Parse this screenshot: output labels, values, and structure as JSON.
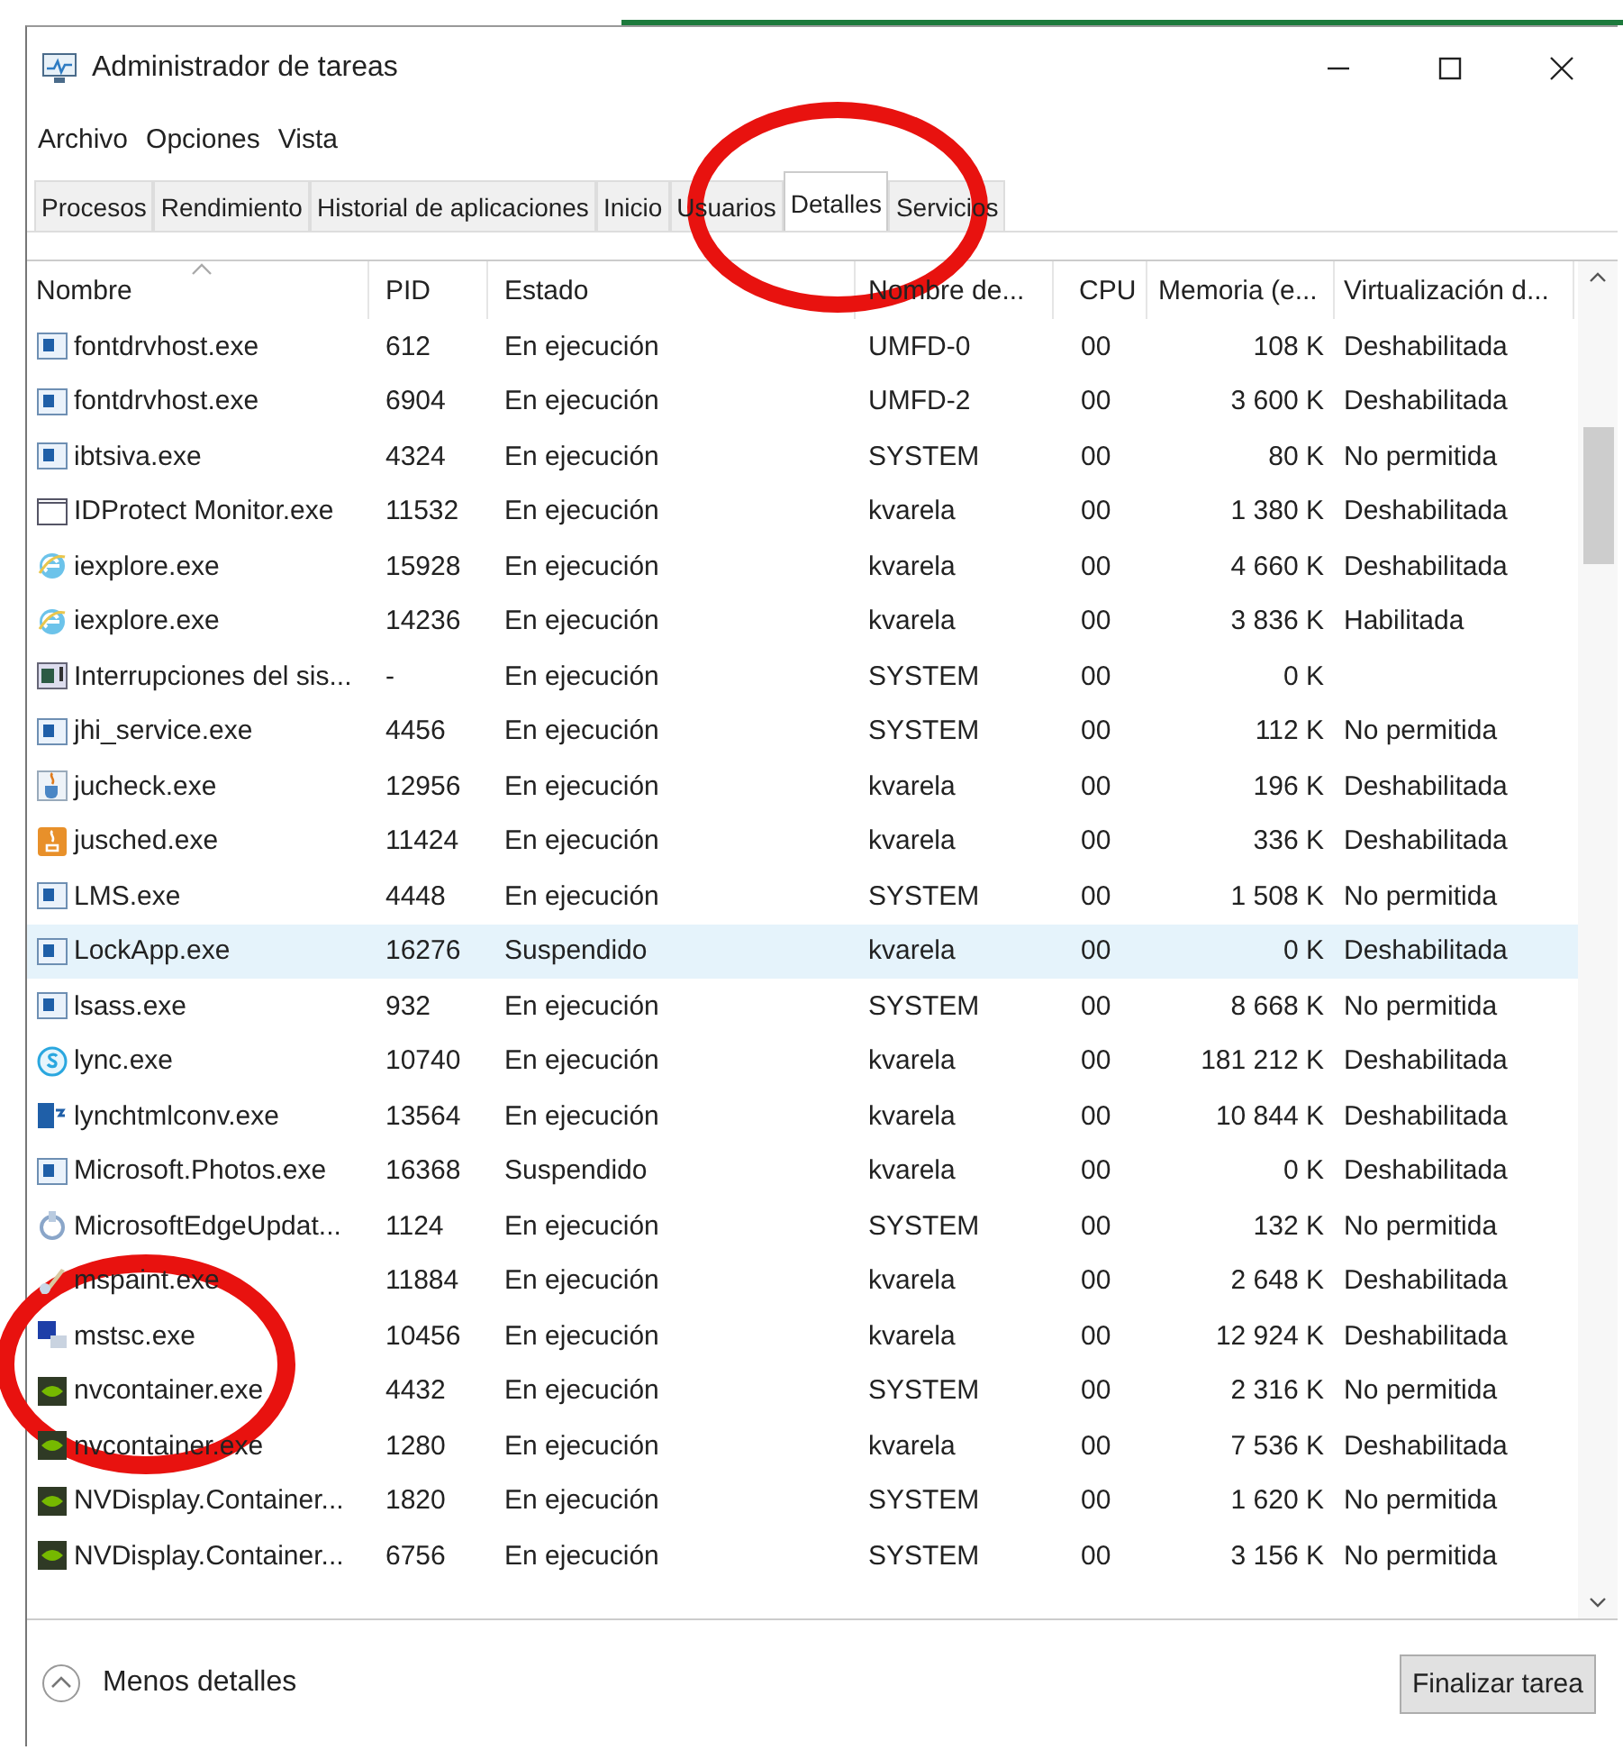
{
  "window": {
    "title": "Administrador de tareas"
  },
  "menu": [
    "Archivo",
    "Opciones",
    "Vista"
  ],
  "tabs": [
    {
      "label": "Procesos",
      "selected": false
    },
    {
      "label": "Rendimiento",
      "selected": false
    },
    {
      "label": "Historial de aplicaciones",
      "selected": false
    },
    {
      "label": "Inicio",
      "selected": false
    },
    {
      "label": "Usuarios",
      "selected": false
    },
    {
      "label": "Detalles",
      "selected": true
    },
    {
      "label": "Servicios",
      "selected": false
    }
  ],
  "table": {
    "columns": [
      "Nombre",
      "PID",
      "Estado",
      "Nombre de...",
      "CPU",
      "Memoria (e...",
      "Virtualización d..."
    ],
    "rows": [
      {
        "kind": "app",
        "cells": [
          "fontdrvhost.exe",
          "612",
          "En ejecución",
          "UMFD-0",
          "00",
          "108 K",
          "Deshabilitada"
        ],
        "selected": false
      },
      {
        "kind": "app",
        "cells": [
          "fontdrvhost.exe",
          "6904",
          "En ejecución",
          "UMFD-2",
          "00",
          "3 600 K",
          "Deshabilitada"
        ],
        "selected": false
      },
      {
        "kind": "app",
        "cells": [
          "ibtsiva.exe",
          "4324",
          "En ejecución",
          "SYSTEM",
          "00",
          "80 K",
          "No permitida"
        ],
        "selected": false
      },
      {
        "kind": "window",
        "cells": [
          "IDProtect Monitor.exe",
          "11532",
          "En ejecución",
          "kvarela",
          "00",
          "1 380 K",
          "Deshabilitada"
        ],
        "selected": false
      },
      {
        "kind": "browser",
        "cells": [
          "iexplore.exe",
          "15928",
          "En ejecución",
          "kvarela",
          "00",
          "4 660 K",
          "Deshabilitada"
        ],
        "selected": false
      },
      {
        "kind": "browser",
        "cells": [
          "iexplore.exe",
          "14236",
          "En ejecución",
          "kvarela",
          "00",
          "3 836 K",
          "Habilitada"
        ],
        "selected": false
      },
      {
        "kind": "system",
        "cells": [
          "Interrupciones del sis...",
          "-",
          "En ejecución",
          "SYSTEM",
          "00",
          "0 K",
          ""
        ],
        "selected": false
      },
      {
        "kind": "app",
        "cells": [
          "jhi_service.exe",
          "4456",
          "En ejecución",
          "SYSTEM",
          "00",
          "112 K",
          "No permitida"
        ],
        "selected": false
      },
      {
        "kind": "cup",
        "cells": [
          "jucheck.exe",
          "12956",
          "En ejecución",
          "kvarela",
          "00",
          "196 K",
          "Deshabilitada"
        ],
        "selected": false
      },
      {
        "kind": "cup-orange",
        "cells": [
          "jusched.exe",
          "11424",
          "En ejecución",
          "kvarela",
          "00",
          "336 K",
          "Deshabilitada"
        ],
        "selected": false
      },
      {
        "kind": "app",
        "cells": [
          "LMS.exe",
          "4448",
          "En ejecución",
          "SYSTEM",
          "00",
          "1 508 K",
          "No permitida"
        ],
        "selected": false
      },
      {
        "kind": "app",
        "cells": [
          "LockApp.exe",
          "16276",
          "Suspendido",
          "kvarela",
          "00",
          "0 K",
          "Deshabilitada"
        ],
        "selected": true
      },
      {
        "kind": "app",
        "cells": [
          "lsass.exe",
          "932",
          "En ejecución",
          "SYSTEM",
          "00",
          "8 668 K",
          "No permitida"
        ],
        "selected": false
      },
      {
        "kind": "chat",
        "cells": [
          "lync.exe",
          "10740",
          "En ejecución",
          "kvarela",
          "00",
          "181 212 K",
          "Deshabilitada"
        ],
        "selected": false
      },
      {
        "kind": "convert",
        "cells": [
          "lynchtmlconv.exe",
          "13564",
          "En ejecución",
          "kvarela",
          "00",
          "10 844 K",
          "Deshabilitada"
        ],
        "selected": false
      },
      {
        "kind": "app",
        "cells": [
          "Microsoft.Photos.exe",
          "16368",
          "Suspendido",
          "kvarela",
          "00",
          "0 K",
          "Deshabilitada"
        ],
        "selected": false
      },
      {
        "kind": "update",
        "cells": [
          "MicrosoftEdgeUpdat...",
          "1124",
          "En ejecución",
          "SYSTEM",
          "00",
          "132 K",
          "No permitida"
        ],
        "selected": false
      },
      {
        "kind": "brush",
        "cells": [
          "mspaint.exe",
          "11884",
          "En ejecución",
          "kvarela",
          "00",
          "2 648 K",
          "Deshabilitada"
        ],
        "selected": false
      },
      {
        "kind": "remote",
        "cells": [
          "mstsc.exe",
          "10456",
          "En ejecución",
          "kvarela",
          "00",
          "12 924 K",
          "Deshabilitada"
        ],
        "selected": false
      },
      {
        "kind": "green",
        "cells": [
          "nvcontainer.exe",
          "4432",
          "En ejecución",
          "SYSTEM",
          "00",
          "2 316 K",
          "No permitida"
        ],
        "selected": false
      },
      {
        "kind": "green",
        "cells": [
          "nvcontainer.exe",
          "1280",
          "En ejecución",
          "kvarela",
          "00",
          "7 536 K",
          "Deshabilitada"
        ],
        "selected": false
      },
      {
        "kind": "green",
        "cells": [
          "NVDisplay.Container...",
          "1820",
          "En ejecución",
          "SYSTEM",
          "00",
          "1 620 K",
          "No permitida"
        ],
        "selected": false
      },
      {
        "kind": "green",
        "cells": [
          "NVDisplay.Container...",
          "6756",
          "En ejecución",
          "SYSTEM",
          "00",
          "3 156 K",
          "No permitida"
        ],
        "selected": false
      }
    ]
  },
  "footer": {
    "toggle": "Menos detalles",
    "button": "Finalizar tarea"
  }
}
